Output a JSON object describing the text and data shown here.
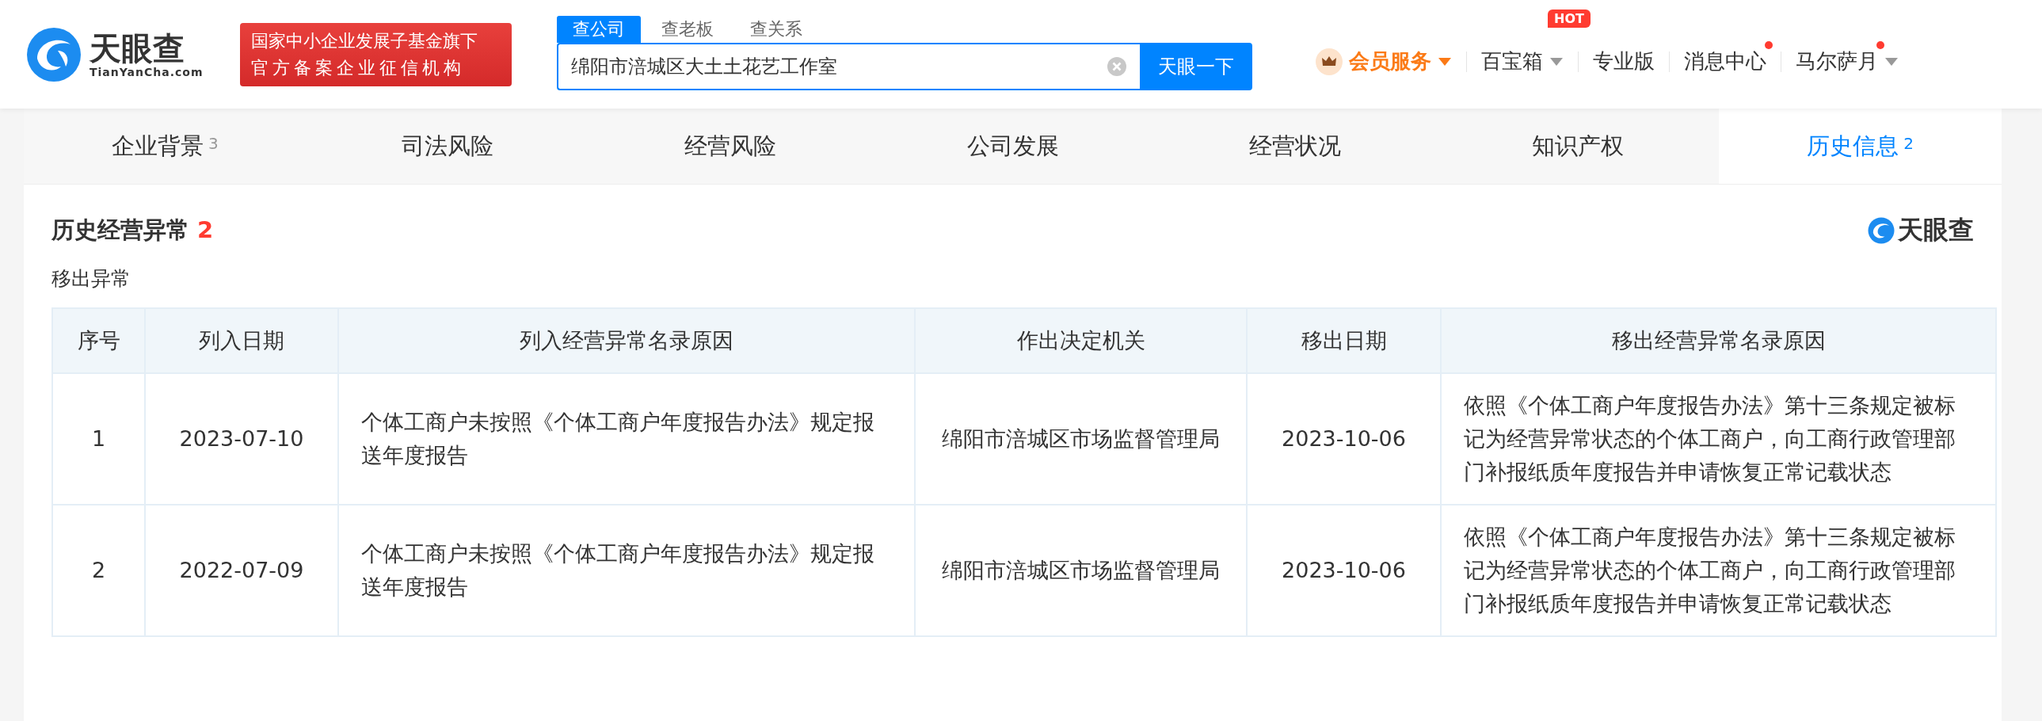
{
  "header": {
    "logo": {
      "name": "天眼查",
      "domain": "TianYanCha.com"
    },
    "slogan": [
      "国家中小企业发展子基金旗下",
      "官方备案企业征信机构"
    ],
    "search": {
      "tabs": [
        {
          "label": "查公司",
          "selected": true
        },
        {
          "label": "查老板",
          "selected": false
        },
        {
          "label": "查关系",
          "selected": false
        }
      ],
      "value": "绵阳市涪城区大土土花艺工作室",
      "button": "天眼一下"
    },
    "nav": [
      {
        "kind": "vip",
        "label": "会员服务",
        "dropdown": true,
        "dot": false
      },
      {
        "kind": "menu",
        "label": "百宝箱",
        "dropdown": true,
        "badge": "HOT",
        "dot": false
      },
      {
        "kind": "link",
        "label": "专业版",
        "dropdown": false,
        "dot": false
      },
      {
        "kind": "link",
        "label": "消息中心",
        "dropdown": false,
        "dot": true
      },
      {
        "kind": "user",
        "label": "马尔萨月",
        "dropdown": true,
        "dot": true
      }
    ]
  },
  "tabs": [
    {
      "label": "企业背景",
      "count": "3",
      "selected": false
    },
    {
      "label": "司法风险",
      "selected": false
    },
    {
      "label": "经营风险",
      "selected": false
    },
    {
      "label": "公司发展",
      "selected": false
    },
    {
      "label": "经营状况",
      "selected": false
    },
    {
      "label": "知识产权",
      "selected": false
    },
    {
      "label": "历史信息",
      "count": "2",
      "selected": true
    }
  ],
  "section": {
    "title": "历史经营异常",
    "count": "2",
    "brand": "天眼查",
    "subtitle": "移出异常",
    "table": {
      "columns": [
        "序号",
        "列入日期",
        "列入经营异常名录原因",
        "作出决定机关",
        "移出日期",
        "移出经营异常名录原因"
      ],
      "rows": [
        [
          "1",
          "2023-07-10",
          "个体工商户未按照《个体工商户年度报告办法》规定报送年度报告",
          "绵阳市涪城区市场监督管理局",
          "2023-10-06",
          "依照《个体工商户年度报告办法》第十三条规定被标记为经营异常状态的个体工商户，向工商行政管理部门补报纸质年度报告并申请恢复正常记载状态"
        ],
        [
          "2",
          "2022-07-09",
          "个体工商户未按照《个体工商户年度报告办法》规定报送年度报告",
          "绵阳市涪城区市场监督管理局",
          "2023-10-06",
          "依照《个体工商户年度报告办法》第十三条规定被标记为经营异常状态的个体工商户，向工商行政管理部门补报纸质年度报告并申请恢复正常记载状态"
        ]
      ]
    }
  }
}
